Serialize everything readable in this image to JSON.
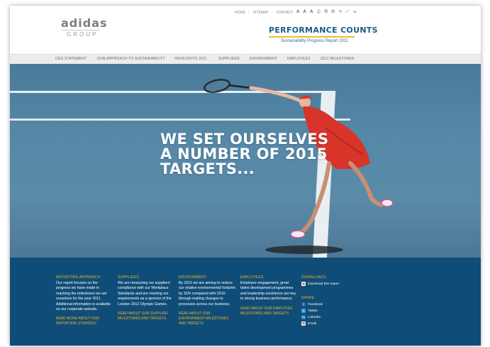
{
  "header": {
    "logo_word": "adidas",
    "logo_sub": "GROUP",
    "top_links": [
      "HOME",
      "SITEMAP",
      "CONTACT"
    ],
    "font_sizes": "A A A",
    "tools": "⎙ ▤ ▥ ✉ ⤢ ☰",
    "title": "PERFORMANCE COUNTS",
    "subtitle": "Sustainability Progress Report 2011"
  },
  "menu": {
    "items": [
      "CEO STATEMENT",
      "OUR APPROACH TO SUSTAINABILITY",
      "HIGHLIGHTS 2011",
      "SUPPLIERS",
      "ENVIRONMENT",
      "EMPLOYEES",
      "2012 MILESTONES"
    ]
  },
  "hero": {
    "lines": [
      "WE SET OURSELVES",
      "A NUMBER OF 2015",
      "TARGETS..."
    ]
  },
  "footer": {
    "columns": [
      {
        "heading": "REPORTING APPROACH",
        "text": "Our report focuses on the progress we have made in reaching the milestones we set ourselves for the year 2011. Additional information is available on our corporate website.",
        "link": "READ MORE ABOUT OUR REPORTING STRATEGY"
      },
      {
        "heading": "SUPPLIERS",
        "text": "We are measuring our suppliers' compliance with our Workplace Standards and are meeting our requirements as a sponsor of the London 2012 Olympic Games.",
        "link": "READ ABOUT OUR SUPPLIER MILESTONES AND TARGETS"
      },
      {
        "heading": "ENVIRONMENT",
        "text": "By 2015 we are aiming to reduce our relative environmental footprint by 15% compared with 2010 through making changes to processes across our business.",
        "link": "READ ABOUT OUR ENVIRONMENT MILESTONES AND TARGETS"
      },
      {
        "heading": "EMPLOYEES",
        "text": "Employee engagement, great talent development programmes and leadership excellence are key to strong business performance.",
        "link": "READ ABOUT OUR EMPLOYEE MILESTONES AND TARGETS"
      }
    ],
    "downloads": {
      "heading": "DOWNLOADS",
      "item": "Download this report"
    },
    "share": {
      "heading": "SHARE",
      "items": [
        "Facebook",
        "Twitter",
        "LinkedIn",
        "Email"
      ]
    }
  },
  "colors": {
    "brand_blue": "#1c5a87",
    "accent_yellow": "#f0b323",
    "footer_bg": "#0f4d78",
    "player_red": "#d8342a"
  }
}
